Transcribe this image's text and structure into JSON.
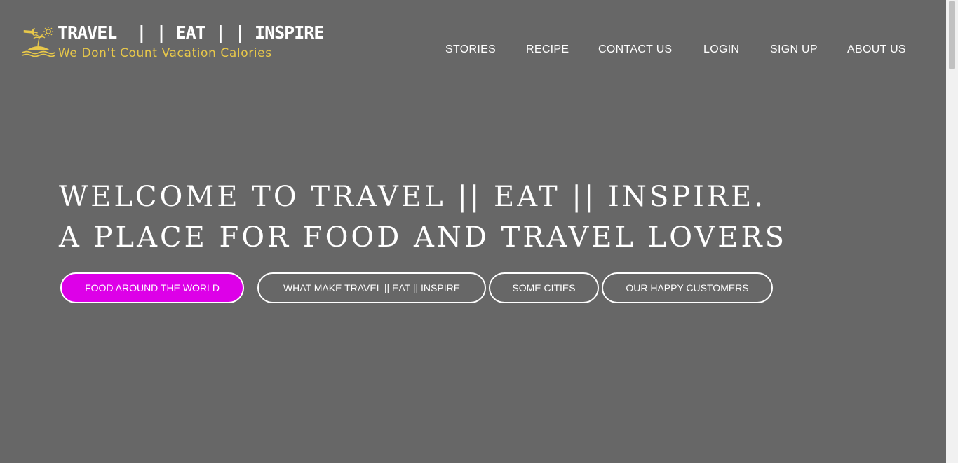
{
  "logo": {
    "title": "TRAVEL  | | EAT | | INSPIRE",
    "tagline": "We Don't Count Vacation Calories",
    "icon": "plane-sun-island-icon",
    "title_color": "#ffffff",
    "tagline_color": "#e8c84a"
  },
  "nav": {
    "items": [
      {
        "label": "STORIES"
      },
      {
        "label": "RECIPE"
      },
      {
        "label": "CONTACT US"
      },
      {
        "label": "LOGIN"
      },
      {
        "label": "SIGN UP"
      },
      {
        "label": "ABOUT US"
      }
    ]
  },
  "hero": {
    "line1": "WELCOME TO TRAVEL || EAT || INSPIRE.",
    "line2": "A PLACE FOR FOOD AND TRAVEL LOVERS"
  },
  "buttons": [
    {
      "label": "FOOD AROUND THE WORLD",
      "active": true
    },
    {
      "label": "WHAT MAKE TRAVEL || EAT || INSPIRE",
      "active": false
    },
    {
      "label": "SOME CITIES",
      "active": false
    },
    {
      "label": "OUR HAPPY CUSTOMERS",
      "active": false
    }
  ],
  "colors": {
    "background": "#676767",
    "accent": "#dd00e8",
    "text": "#ffffff"
  }
}
